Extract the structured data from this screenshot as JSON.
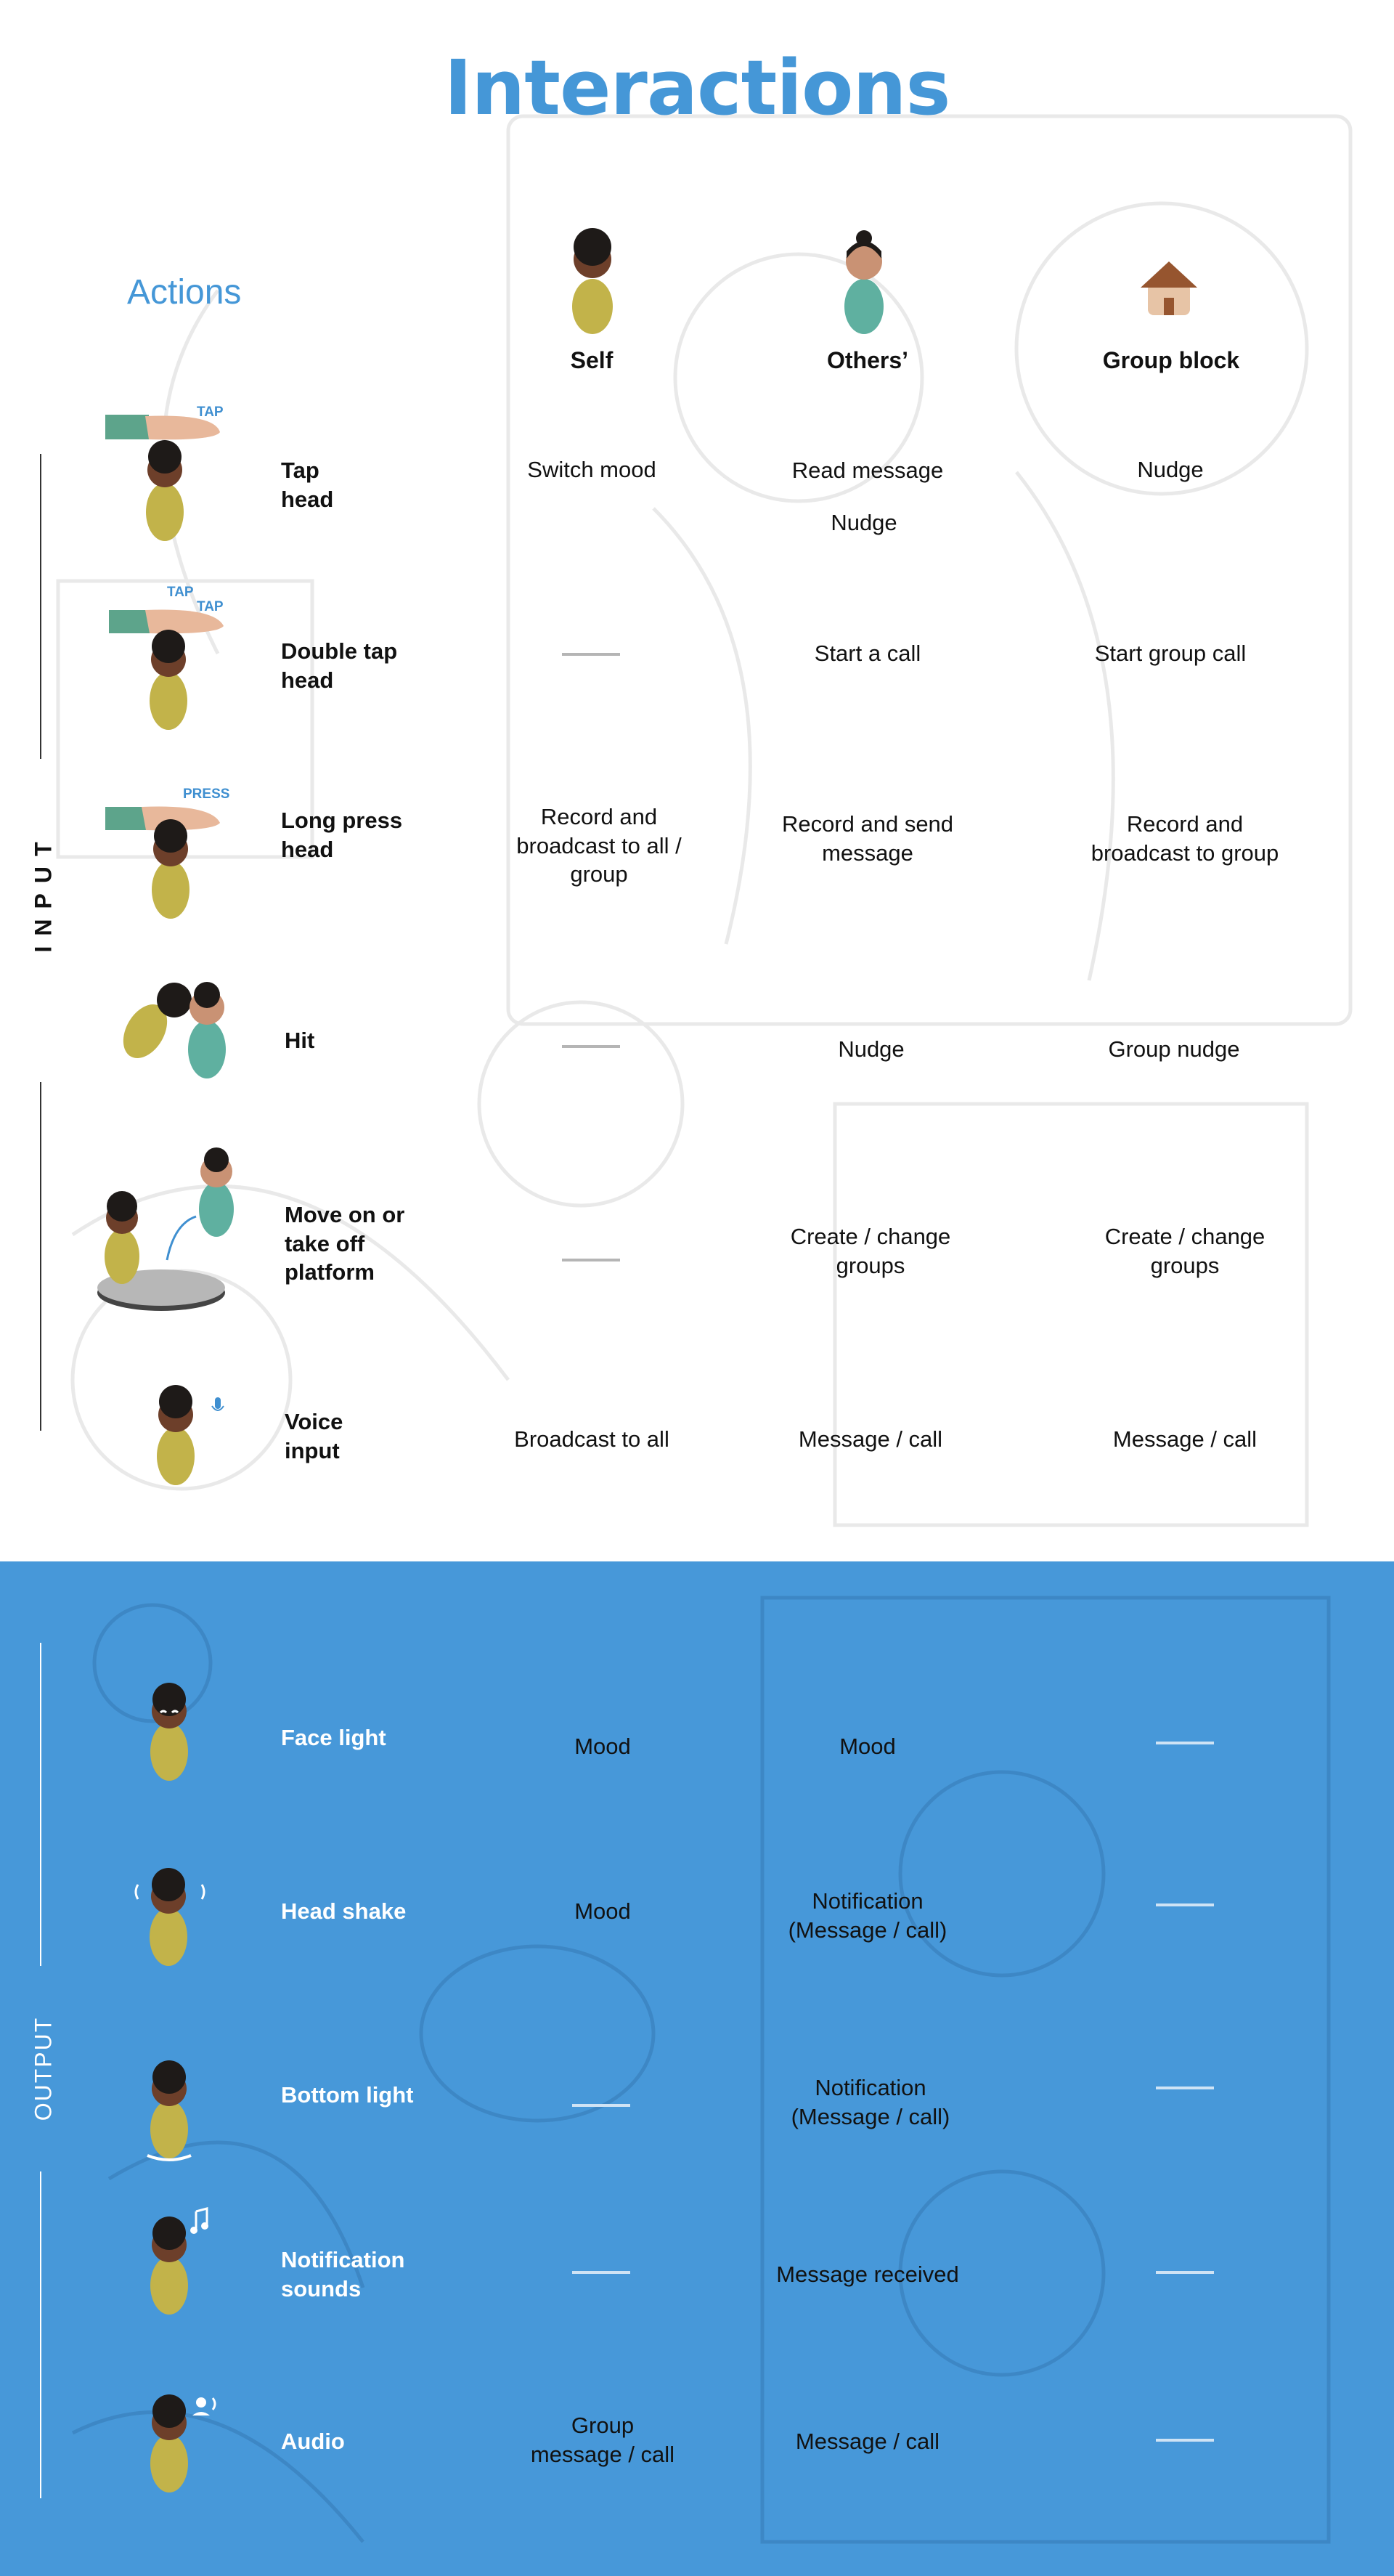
{
  "page": {
    "title": "Interactions"
  },
  "actions_heading": "Actions",
  "columns": {
    "self": "Self",
    "others": "Others’",
    "group": "Group block"
  },
  "input_label": "INPUT",
  "output_label": "OUTPUT",
  "badges": {
    "tap": "TAP",
    "tap2a": "TAP",
    "tap2b": "TAP",
    "press": "PRESS"
  },
  "input_rows": [
    {
      "label": "Tap\nhead",
      "self": "Switch mood",
      "others": "Read message",
      "others2": "Nudge",
      "group": "Nudge"
    },
    {
      "label": "Double tap\nhead",
      "self": "",
      "others": "Start a call",
      "group": "Start group call"
    },
    {
      "label": "Long press\nhead",
      "self": "Record and\nbroadcast to all /\ngroup",
      "others": "Record and send\nmessage",
      "group": "Record and\nbroadcast to group"
    },
    {
      "label": "Hit",
      "self": "",
      "others": "Nudge",
      "group": "Group nudge"
    },
    {
      "label": "Move on or\ntake off\nplatform",
      "self": "",
      "others": "Create / change\ngroups",
      "group": "Create / change\ngroups"
    },
    {
      "label": "Voice\ninput",
      "self": "Broadcast to all",
      "others": "Message / call",
      "group": "Message / call"
    }
  ],
  "output_rows": [
    {
      "label": "Face light",
      "self": "Mood",
      "others": "Mood",
      "group": ""
    },
    {
      "label": "Head shake",
      "self": "Mood",
      "others": "Notification\n(Message / call)",
      "group": ""
    },
    {
      "label": "Bottom light",
      "self": "",
      "others": "Notification\n(Message / call)",
      "group": ""
    },
    {
      "label": "Notification\nsounds",
      "self": "",
      "others": "Message received",
      "group": ""
    },
    {
      "label": "Audio",
      "self": "Group\nmessage / call",
      "others": "Message / call",
      "group": ""
    }
  ],
  "colors": {
    "accent": "#4597d7",
    "output_bg": "#4798d9",
    "doll_body": "#c2b34a",
    "doll_skin": "#6d3f2a",
    "teal": "#5fb0a0",
    "hand": "#e8b89b",
    "sleeve": "#5da48b"
  }
}
